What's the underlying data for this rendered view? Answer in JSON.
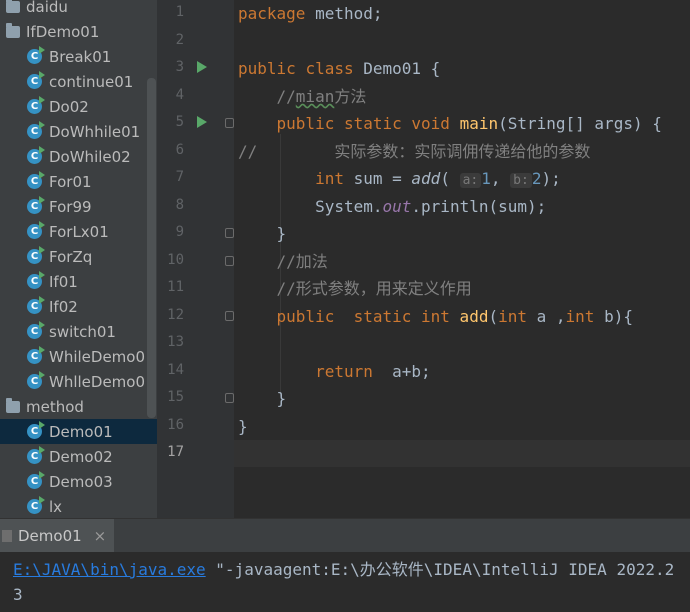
{
  "project_tree": {
    "items": [
      {
        "label": "daidu",
        "kind": "package"
      },
      {
        "label": "IfDemo01",
        "kind": "package"
      },
      {
        "label": "Break01",
        "kind": "class"
      },
      {
        "label": "continue01",
        "kind": "class"
      },
      {
        "label": "Do02",
        "kind": "class"
      },
      {
        "label": "DoWhhile01",
        "kind": "class"
      },
      {
        "label": "DoWhile02",
        "kind": "class"
      },
      {
        "label": "For01",
        "kind": "class"
      },
      {
        "label": "For99",
        "kind": "class"
      },
      {
        "label": "ForLx01",
        "kind": "class"
      },
      {
        "label": "ForZq",
        "kind": "class"
      },
      {
        "label": "If01",
        "kind": "class"
      },
      {
        "label": "If02",
        "kind": "class"
      },
      {
        "label": "switch01",
        "kind": "class"
      },
      {
        "label": "WhileDemo0",
        "kind": "class"
      },
      {
        "label": "WhlleDemo0",
        "kind": "class"
      },
      {
        "label": "method",
        "kind": "package"
      },
      {
        "label": "Demo01",
        "kind": "class",
        "selected": true
      },
      {
        "label": "Demo02",
        "kind": "class"
      },
      {
        "label": "Demo03",
        "kind": "class"
      },
      {
        "label": "lx",
        "kind": "class"
      }
    ]
  },
  "editor": {
    "line_numbers": [
      "1",
      "2",
      "3",
      "4",
      "5",
      "6",
      "7",
      "8",
      "9",
      "10",
      "11",
      "12",
      "13",
      "14",
      "15",
      "16",
      "17"
    ],
    "current_line": "17",
    "code": {
      "l1_kw": "package",
      "l1_rest": " method;",
      "l3_kw1": "public",
      "l3_kw2": "class",
      "l3_name": " Demo01 {",
      "l4_comment_pre": "//",
      "l4_comment_typo": "mian",
      "l4_comment_post": "方法",
      "l5_kw": "public static void",
      "l5_fn": "main",
      "l5_rest": "(String[] args) {",
      "l6_comment": "//        实际参数：实际调佣传递给他的参数",
      "l7_kw": "int",
      "l7_mid": " sum = ",
      "l7_call": "add",
      "l7_open": "(",
      "l7_hint_a": "a:",
      "l7_arg1": "1",
      "l7_sep": ", ",
      "l7_hint_b": "b:",
      "l7_arg2": "2",
      "l7_close": ");",
      "l8_pre": "System.",
      "l8_field": "out",
      "l8_post": ".println(sum);",
      "l9": "}",
      "l10_comment": "//加法",
      "l11_comment": "//形式参数，用来定义作用",
      "l12_kw1": "public",
      "l12_kw2": "  static int",
      "l12_fn": " add",
      "l12_p1": "(",
      "l12_int1": "int",
      "l12_a": " a ,",
      "l12_int2": "int",
      "l12_b": " b){",
      "l14_kw": "return",
      "l14_rest": "  a+b;",
      "l15": "}",
      "l16": "}"
    }
  },
  "run_panel": {
    "tab_label": "Demo01",
    "close_glyph": "×",
    "console": {
      "java_path": "E:\\JAVA\\bin\\java.exe",
      "args": " \"-javaagent:E:\\办公软件\\IDEA\\IntelliJ IDEA 2022.2",
      "output": "3"
    }
  },
  "colors": {
    "background": "#2b2b2b",
    "keyword": "#cc7832",
    "function": "#ffc66d",
    "comment": "#808080",
    "number": "#6897bb",
    "field": "#9876aa",
    "selection": "#0d293e",
    "link": "#287bde"
  }
}
